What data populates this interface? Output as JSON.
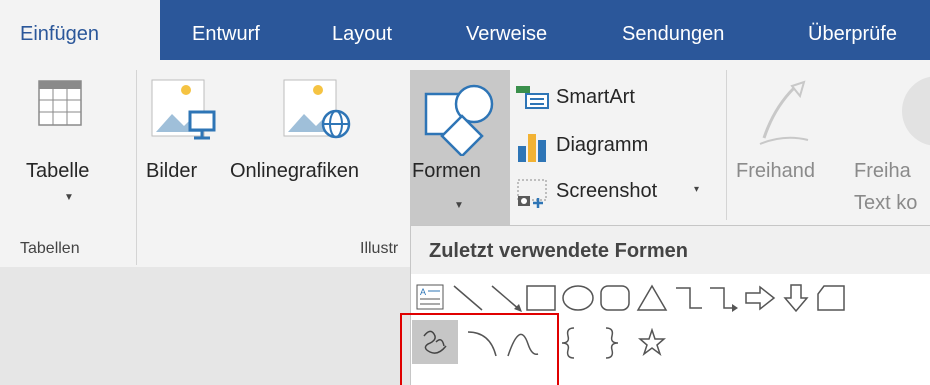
{
  "tabs": [
    {
      "label": "Einfügen",
      "active": true
    },
    {
      "label": "Entwurf",
      "active": false
    },
    {
      "label": "Layout",
      "active": false
    },
    {
      "label": "Verweise",
      "active": false
    },
    {
      "label": "Sendungen",
      "active": false
    },
    {
      "label": "Überprüfe",
      "active": false
    }
  ],
  "ribbon": {
    "tabelle": {
      "label": "Tabelle",
      "icon": "table-icon"
    },
    "bilder": {
      "label": "Bilder",
      "icon": "picture-icon"
    },
    "onlinegrafiken": {
      "label": "Onlinegrafiken",
      "icon": "online-picture-icon"
    },
    "formen": {
      "label": "Formen",
      "icon": "shapes-icon"
    },
    "smartart": {
      "label": "SmartArt",
      "icon": "smartart-icon"
    },
    "diagramm": {
      "label": "Diagramm",
      "icon": "chart-icon"
    },
    "screenshot": {
      "label": "Screenshot",
      "icon": "screenshot-icon"
    },
    "freihand": {
      "label": "Freihand",
      "icon": "pen-icon"
    },
    "freihand2": {
      "line1": "Freiha",
      "line2": "Text ko"
    },
    "groups": {
      "tabellen": "Tabellen",
      "illustr": "Illustr"
    }
  },
  "gallery": {
    "title": "Zuletzt verwendete Formen",
    "row1": [
      "text-box-icon",
      "line-icon",
      "arrow-line-icon",
      "rectangle-icon",
      "oval-icon",
      "rounded-rectangle-icon",
      "triangle-icon",
      "elbow-connector-icon",
      "elbow-arrow-connector-icon",
      "right-arrow-icon",
      "down-arrow-icon",
      "flowchart-icon"
    ],
    "row2": [
      "scribble-icon",
      "arc-icon",
      "curve-icon",
      "left-brace-icon",
      "right-brace-icon",
      "star-icon"
    ]
  },
  "colors": {
    "tabbar": "#2b579a",
    "ribbon": "#f3f3f3",
    "highlight": "#e00000"
  }
}
